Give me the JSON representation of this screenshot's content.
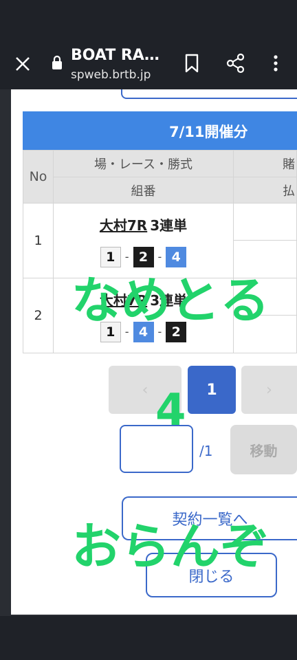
{
  "browser": {
    "title": "BOAT RA…",
    "url": "spweb.brtb.jp"
  },
  "table": {
    "date_header": "7/11開催分",
    "col_no": "No",
    "col_race": "場・レース・勝式",
    "col_combo": "組番",
    "col_bet_partial": "賭",
    "col_pay_partial": "払",
    "rows": [
      {
        "no": "1",
        "race": "大村7R",
        "type": "3連単",
        "combo": [
          "1",
          "2",
          "4"
        ]
      },
      {
        "no": "2",
        "race": "大村7R",
        "type": "3連単",
        "combo": [
          "1",
          "4",
          "2"
        ]
      }
    ],
    "dash": "-"
  },
  "pager": {
    "prev": "‹",
    "current": "1",
    "next": "›",
    "input_value": "",
    "total": "/1",
    "move_label": "移動"
  },
  "buttons": {
    "contract_list": "契約一覧へ",
    "close": "閉じる"
  },
  "overlays": {
    "text1": "なめとる",
    "text2": "4",
    "text3": "おらんぞ"
  },
  "colors": {
    "accent": "#3f86e3",
    "overlay_text": "#22d36b"
  }
}
